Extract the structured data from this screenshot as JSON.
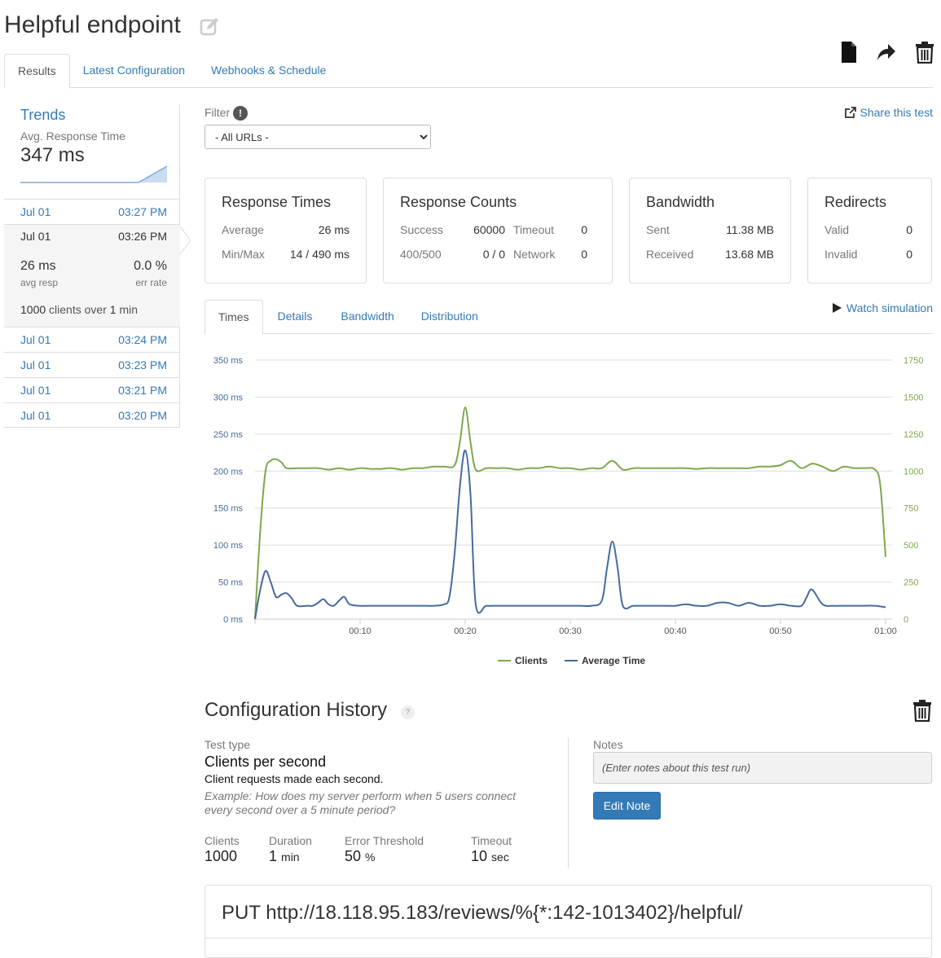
{
  "header": {
    "title": "Helpful endpoint"
  },
  "tabs": [
    {
      "label": "Results"
    },
    {
      "label": "Latest Configuration"
    },
    {
      "label": "Webhooks & Schedule"
    }
  ],
  "sidebar": {
    "trends_title": "Trends",
    "trend_metric": "Avg. Response Time",
    "trend_value": "347 ms",
    "runs": [
      {
        "date": "Jul 01",
        "time": "03:27 PM"
      },
      {
        "date": "Jul 01",
        "time": "03:26 PM",
        "avg": "26 ms",
        "avg_label": "avg resp",
        "err": "0.0 %",
        "err_label": "err rate",
        "clients": "1000",
        "clients_mid": "clients over",
        "duration_num": "1",
        "duration_unit": "min"
      },
      {
        "date": "Jul 01",
        "time": "03:24 PM"
      },
      {
        "date": "Jul 01",
        "time": "03:23 PM"
      },
      {
        "date": "Jul 01",
        "time": "03:21 PM"
      },
      {
        "date": "Jul 01",
        "time": "03:20 PM"
      }
    ]
  },
  "filter": {
    "label": "Filter",
    "info": "!",
    "selected": "- All URLs -"
  },
  "share_label": "Share this test",
  "cards": {
    "response_times": {
      "title": "Response Times",
      "average_label": "Average",
      "average": "26 ms",
      "minmax_label": "Min/Max",
      "minmax": "14 / 490 ms"
    },
    "response_counts": {
      "title": "Response Counts",
      "success_label": "Success",
      "success": "60000",
      "timeout_label": "Timeout",
      "timeout": "0",
      "errors_label": "400/500",
      "errors": "0 / 0",
      "network_label": "Network",
      "network": "0"
    },
    "bandwidth": {
      "title": "Bandwidth",
      "sent_label": "Sent",
      "sent": "11.38 MB",
      "received_label": "Received",
      "received": "13.68 MB"
    },
    "redirects": {
      "title": "Redirects",
      "valid_label": "Valid",
      "valid": "0",
      "invalid_label": "Invalid",
      "invalid": "0"
    }
  },
  "chart_tabs": [
    {
      "label": "Times"
    },
    {
      "label": "Details"
    },
    {
      "label": "Bandwidth"
    },
    {
      "label": "Distribution"
    }
  ],
  "watch_label": "Watch simulation",
  "colors": {
    "clients": "#7ea84c",
    "average_time": "#456a9e",
    "accent": "#337ab7"
  },
  "chart_data": {
    "type": "line",
    "x_ticks": [
      "00:10",
      "00:20",
      "00:30",
      "00:40",
      "00:50",
      "01:00"
    ],
    "y_left_ticks": [
      "0 ms",
      "50 ms",
      "100 ms",
      "150 ms",
      "200 ms",
      "250 ms",
      "300 ms",
      "350 ms"
    ],
    "y_right_ticks": [
      "0",
      "250",
      "500",
      "750",
      "1000",
      "1250",
      "1500",
      "1750"
    ],
    "ylim_left": [
      0,
      350
    ],
    "ylim_right": [
      0,
      1750
    ],
    "xlim": [
      0,
      60
    ],
    "grid": true,
    "legend_position": "bottom",
    "series": [
      {
        "name": "Clients",
        "axis": "right",
        "x": [
          0,
          0.5,
          1,
          1.5,
          2,
          2.5,
          3,
          4,
          5,
          6,
          7,
          8,
          9,
          10,
          11,
          12,
          13,
          14,
          15,
          16,
          17,
          18,
          19,
          19.5,
          20,
          20.5,
          21,
          22,
          23,
          24,
          25,
          26,
          27,
          28,
          29,
          30,
          31,
          32,
          33,
          34,
          35,
          36,
          37,
          38,
          39,
          40,
          41,
          42,
          43,
          44,
          45,
          46,
          47,
          48,
          49,
          50,
          51,
          52,
          53,
          54,
          55,
          56,
          57,
          58,
          59,
          59.5,
          60
        ],
        "values": [
          0,
          600,
          1000,
          1070,
          1080,
          1060,
          1020,
          1020,
          1020,
          1020,
          1010,
          1020,
          1010,
          1020,
          1015,
          1015,
          1020,
          1010,
          1020,
          1020,
          1030,
          1030,
          1040,
          1200,
          1430,
          1200,
          1010,
          1020,
          1020,
          1020,
          1010,
          1020,
          1020,
          1030,
          1020,
          1020,
          1010,
          1020,
          1020,
          1070,
          1010,
          1020,
          1020,
          1020,
          1020,
          1020,
          1020,
          1015,
          1020,
          1020,
          1020,
          1020,
          1020,
          1030,
          1030,
          1040,
          1070,
          1020,
          1050,
          1030,
          1000,
          1030,
          1020,
          1020,
          1010,
          900,
          420
        ]
      },
      {
        "name": "Average Time",
        "axis": "left",
        "x": [
          0,
          0.5,
          1,
          1.5,
          2,
          2.5,
          3,
          3.5,
          4,
          5,
          5.5,
          6,
          6.5,
          7,
          7.5,
          8,
          8.5,
          9,
          10,
          11,
          12,
          13,
          14,
          15,
          16,
          17,
          18,
          18.5,
          19,
          19.5,
          20,
          20.5,
          21,
          22,
          23,
          24,
          25,
          26,
          27,
          28,
          29,
          30,
          31,
          32,
          33,
          33.5,
          34,
          34.5,
          35,
          36,
          37,
          38,
          39,
          40,
          41,
          42,
          43,
          44,
          45,
          46,
          47,
          48,
          49,
          50,
          51,
          52,
          52.5,
          53,
          54,
          55,
          56,
          57,
          58,
          59,
          60
        ],
        "values": [
          0,
          40,
          65,
          50,
          30,
          33,
          35,
          28,
          18,
          18,
          18,
          22,
          27,
          20,
          18,
          25,
          30,
          20,
          18,
          18,
          18,
          18,
          18,
          18,
          18,
          18,
          20,
          30,
          90,
          180,
          228,
          170,
          20,
          18,
          18,
          18,
          18,
          18,
          18,
          18,
          18,
          18,
          18,
          18,
          25,
          70,
          105,
          70,
          18,
          18,
          18,
          18,
          18,
          18,
          20,
          18,
          18,
          22,
          22,
          18,
          22,
          18,
          18,
          20,
          18,
          18,
          30,
          40,
          20,
          18,
          18,
          18,
          18,
          18,
          16
        ]
      }
    ]
  },
  "config": {
    "title": "Configuration History",
    "help": "?",
    "test_type_label": "Test type",
    "test_type": "Clients per second",
    "test_type_desc": "Client requests made each second.",
    "example": "Example: How does my server perform when 5 users connect every second over a 5 minute period?",
    "params": [
      {
        "label": "Clients",
        "value": "1000",
        "unit": ""
      },
      {
        "label": "Duration",
        "value": "1",
        "unit": "min"
      },
      {
        "label": "Error Threshold",
        "value": "50",
        "unit": "%"
      },
      {
        "label": "Timeout",
        "value": "10",
        "unit": "sec"
      }
    ],
    "notes_label": "Notes",
    "notes_placeholder": "(Enter notes about this test run)",
    "edit_note_label": "Edit Note",
    "request_line": "PUT http://18.118.95.183/reviews/%{*:142-1013402}/helpful/"
  }
}
